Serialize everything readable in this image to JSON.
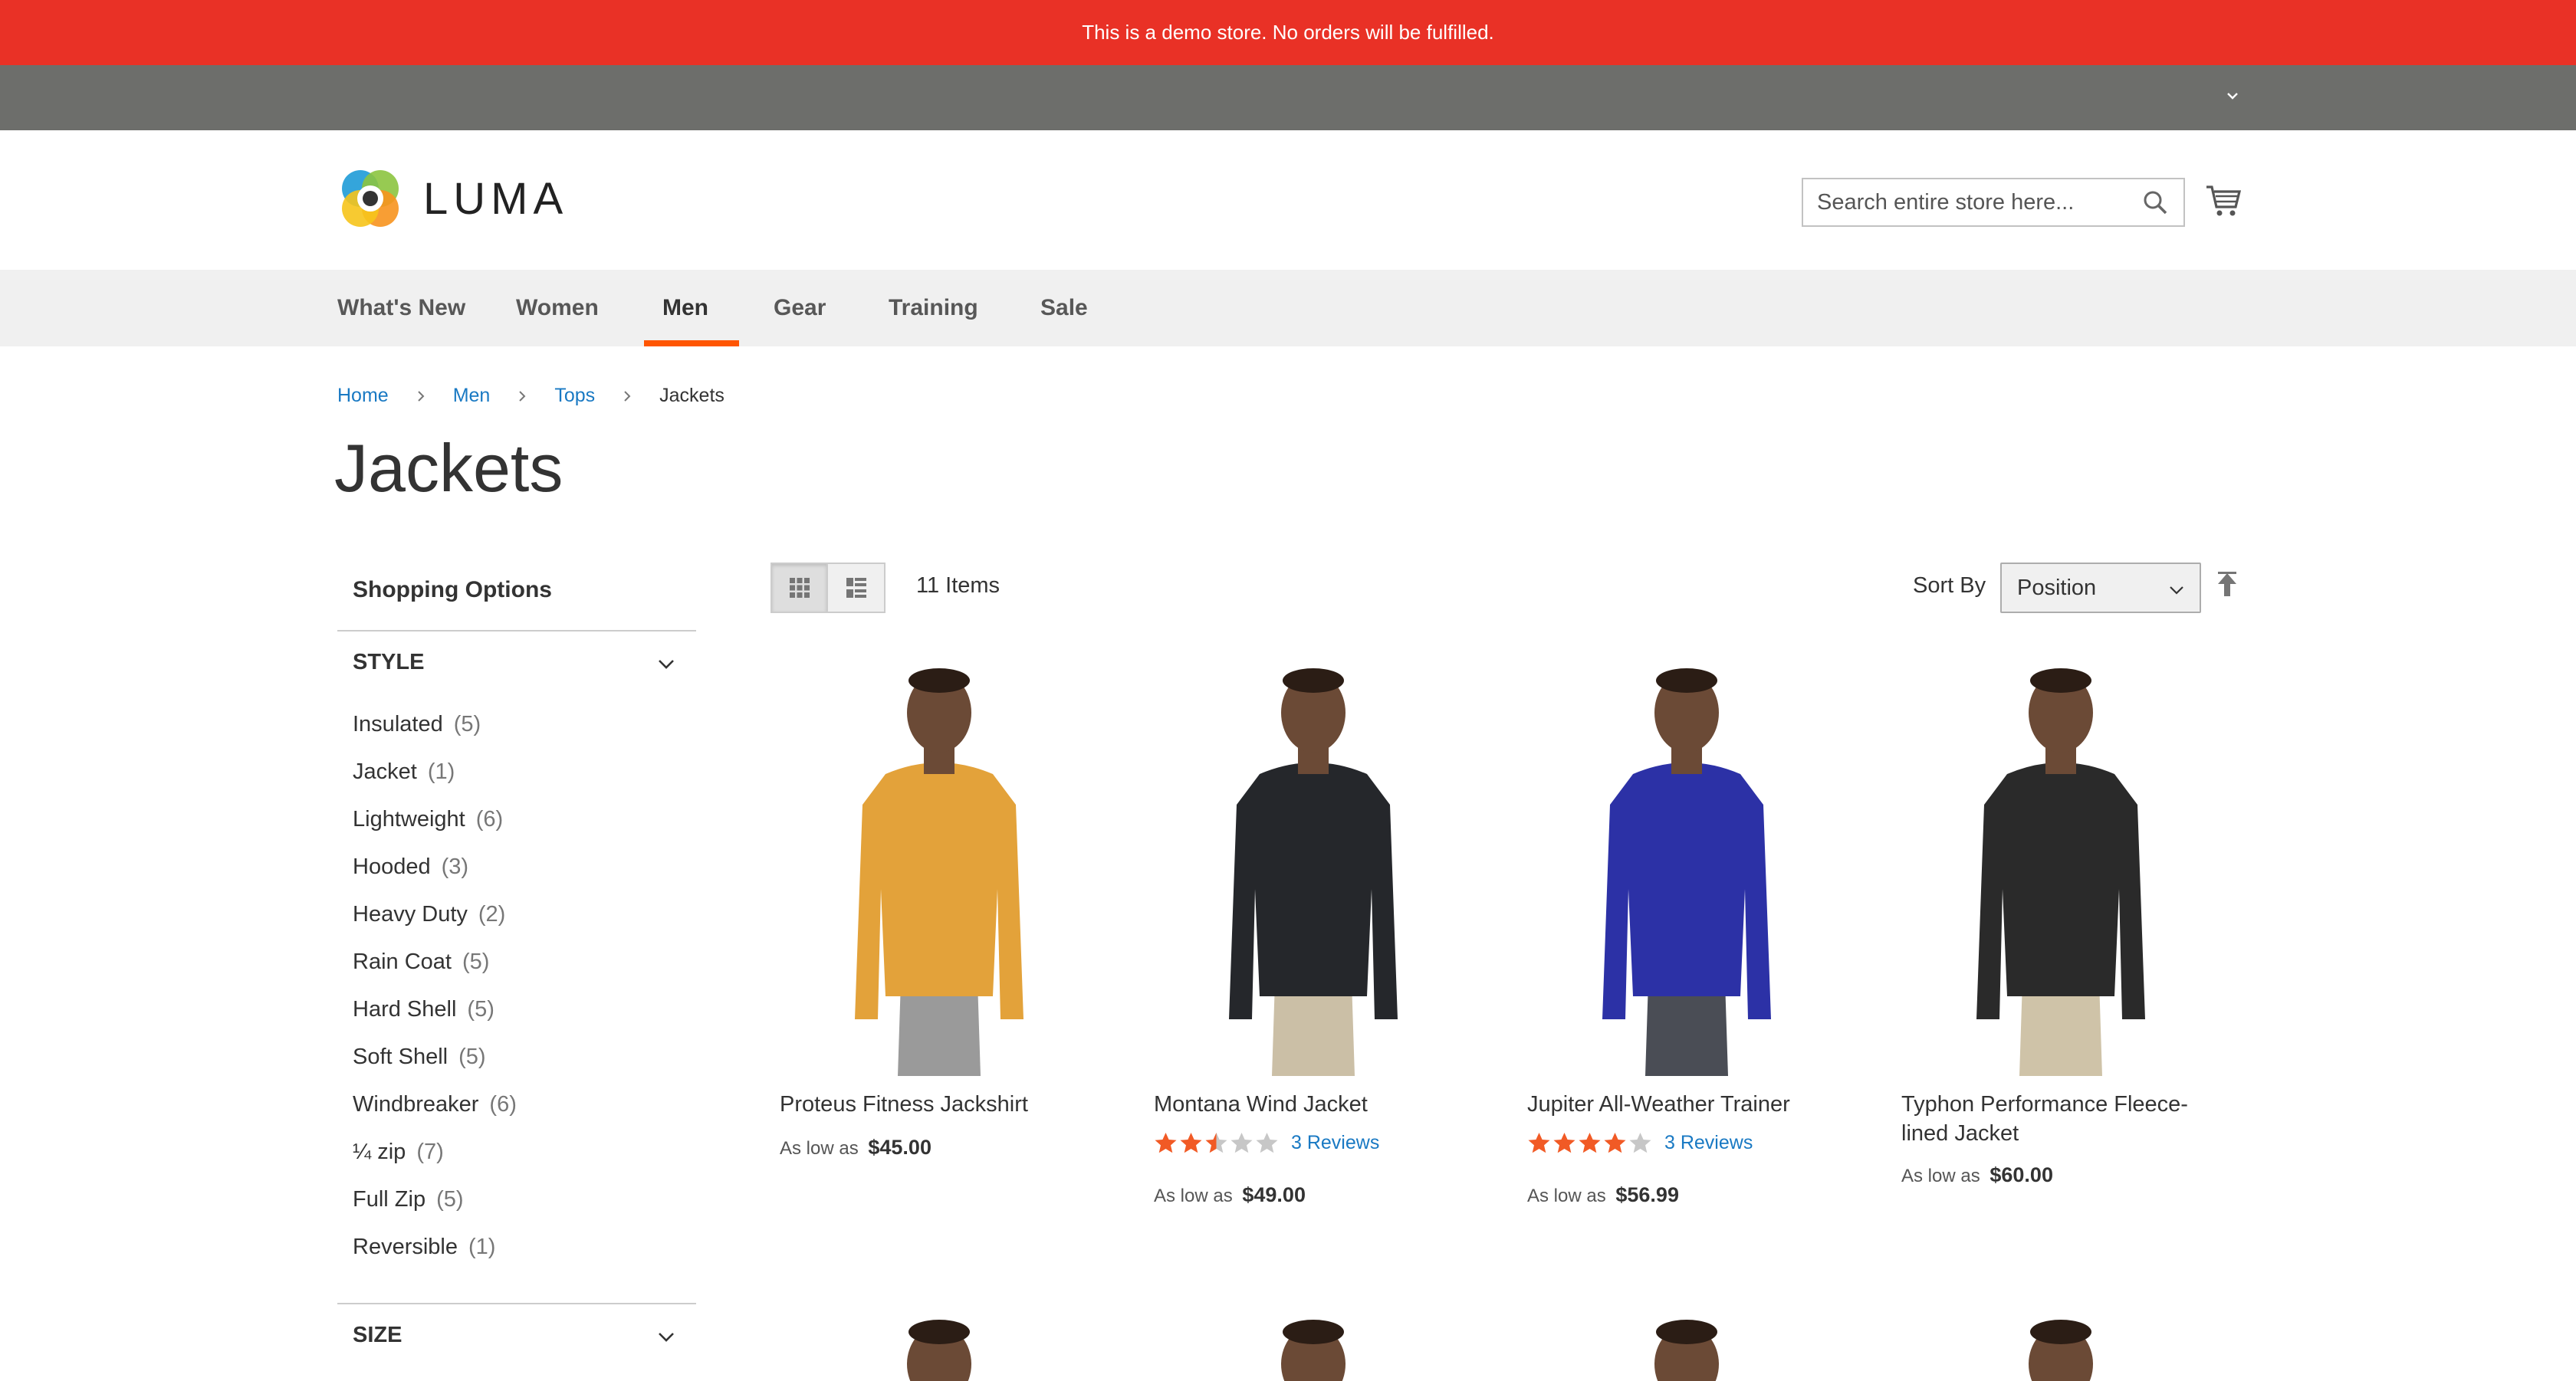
{
  "demo_notice": "This is a demo store. No orders will be fulfilled.",
  "header": {
    "logo_text": "LUMA",
    "search_placeholder": "Search entire store here...",
    "icons": [
      "chevron-down-icon",
      "search-icon",
      "cart-icon"
    ]
  },
  "nav": {
    "items": [
      "What's New",
      "Women",
      "Men",
      "Gear",
      "Training",
      "Sale"
    ],
    "active": "Men"
  },
  "breadcrumb": {
    "home": "Home",
    "men": "Men",
    "tops": "Tops",
    "current": "Jackets"
  },
  "page_title": "Jackets",
  "sidebar": {
    "title": "Shopping Options",
    "style_label": "STYLE",
    "size_label": "SIZE",
    "style_options": [
      {
        "label": "Insulated",
        "count": "(5)"
      },
      {
        "label": "Jacket",
        "count": "(1)"
      },
      {
        "label": "Lightweight",
        "count": "(6)"
      },
      {
        "label": "Hooded",
        "count": "(3)"
      },
      {
        "label": "Heavy Duty",
        "count": "(2)"
      },
      {
        "label": "Rain Coat",
        "count": "(5)"
      },
      {
        "label": "Hard Shell",
        "count": "(5)"
      },
      {
        "label": "Soft Shell",
        "count": "(5)"
      },
      {
        "label": "Windbreaker",
        "count": "(6)"
      },
      {
        "label": "¼ zip",
        "count": "(7)"
      },
      {
        "label": "Full Zip",
        "count": "(5)"
      },
      {
        "label": "Reversible",
        "count": "(1)"
      }
    ]
  },
  "toolbar": {
    "item_count": "11 Items",
    "sort_label": "Sort By",
    "sort_value": "Position",
    "view_modes": [
      "grid",
      "list"
    ],
    "active_mode": "grid"
  },
  "products": [
    {
      "name": "Proteus Fitness Jackshirt",
      "price_prefix": "As low as",
      "price": "$45.00",
      "rating": null,
      "reviews": null,
      "color": "#e3a23a",
      "pants": "#9a9a9a"
    },
    {
      "name": "Montana Wind Jacket",
      "price_prefix": "As low as",
      "price": "$49.00",
      "rating": 2.5,
      "reviews": "3 Reviews",
      "color": "#25272b",
      "pants": "#cbbfa6"
    },
    {
      "name": "Jupiter All-Weather Trainer",
      "price_prefix": "As low as",
      "price": "$56.99",
      "rating": 4,
      "reviews": "3 Reviews",
      "color": "#2c31a6",
      "pants": "#4a4d55"
    },
    {
      "name": "Typhon Performance Fleece-lined Jacket",
      "price_prefix": "As low as",
      "price": "$60.00",
      "rating": null,
      "reviews": null,
      "color": "#2a2a2a",
      "pants": "#cfc3a8"
    }
  ],
  "colors": {
    "demo_bar": "#e93126",
    "top_bar": "#6d6e6b",
    "nav_bg": "#f0f0f0",
    "nav_active_underline": "#ff5501",
    "link": "#1979c3",
    "star": "#f15a25"
  }
}
